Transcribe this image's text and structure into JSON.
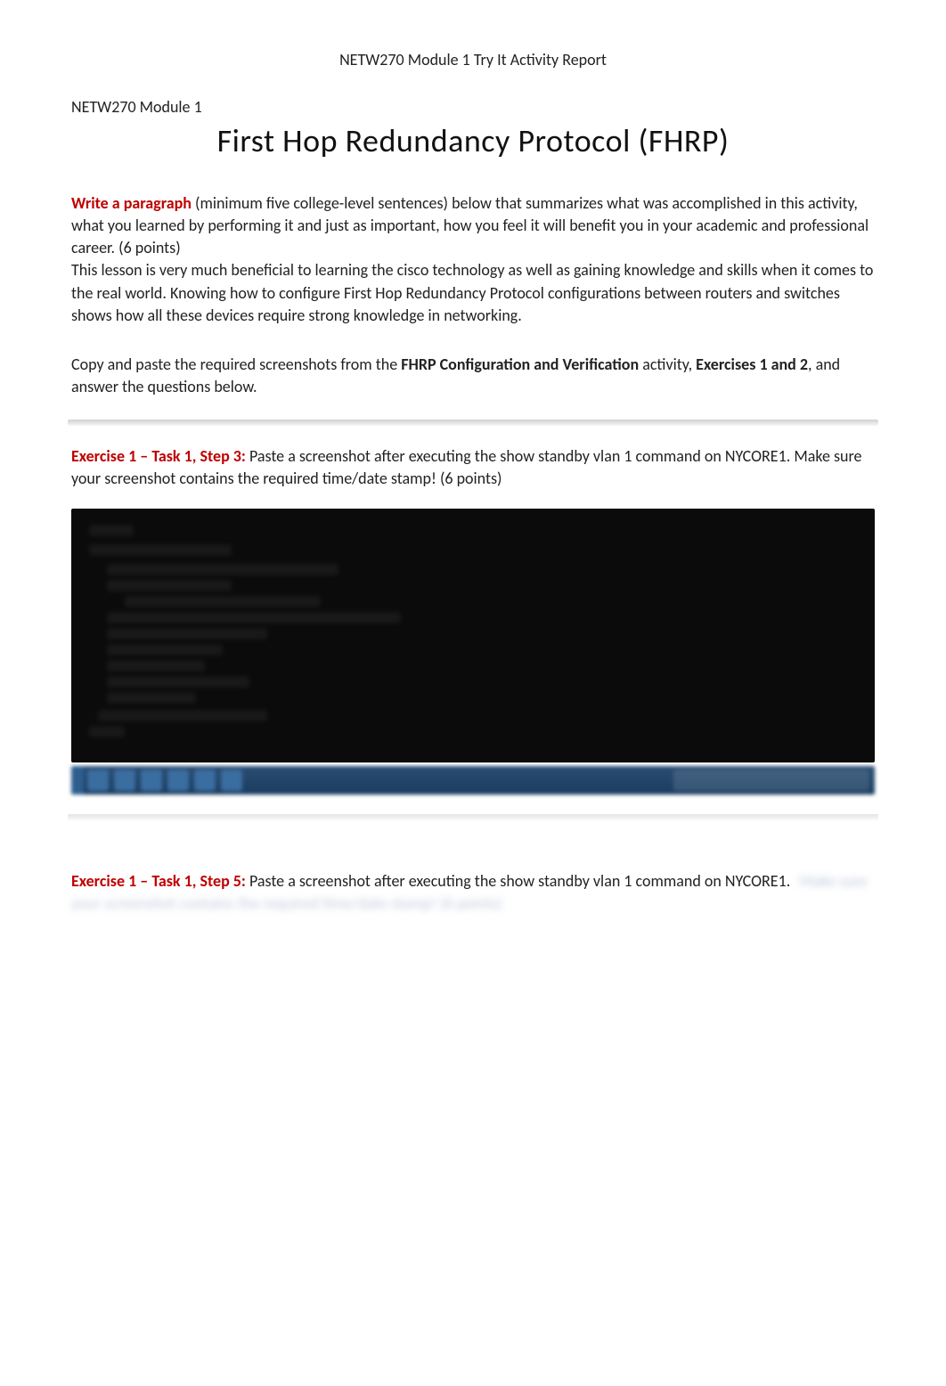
{
  "header": {
    "running_title": "NETW270 Module 1 Try It Activity Report"
  },
  "course": {
    "line": "NETW270 Module 1"
  },
  "title": "First Hop Redundancy Protocol (FHRP)",
  "intro": {
    "prompt_label": "Write a paragraph",
    "prompt_rest": " (minimum five college-level sentences) below that summarizes what was accomplished in this activity, what you learned by performing it and just as important, how you feel it will benefit you in your academic and professional career.   (6 points)",
    "answer": "This lesson is very much beneficial to learning the cisco technology as well as gaining knowledge and skills when it comes to the real world. Knowing how to configure First Hop Redundancy Protocol configurations between routers and switches shows how all these devices require strong knowledge in networking."
  },
  "copy_paste": {
    "pre": "Copy and paste the required screenshots from the ",
    "bold1": "FHRP Configuration and Verification",
    "mid": " activity, ",
    "bold2": "Exercises 1 and 2",
    "post": ", and answer the questions below."
  },
  "ex1_step3": {
    "label": "Exercise 1 – Task 1, Step 3:",
    "text": " Paste a screenshot after executing the show standby vlan 1 command on NYCORE1.   Make sure your screenshot contains the required time/date stamp!  (6 points)"
  },
  "ex1_step5": {
    "label": "Exercise 1 – Task 1, Step 5:",
    "text_visible": " Paste a screenshot after executing the show standby vlan 1 command on NYCORE1.  ",
    "text_obscured": "Make sure your screenshot contains the required time/date stamp!        (6 points)"
  }
}
